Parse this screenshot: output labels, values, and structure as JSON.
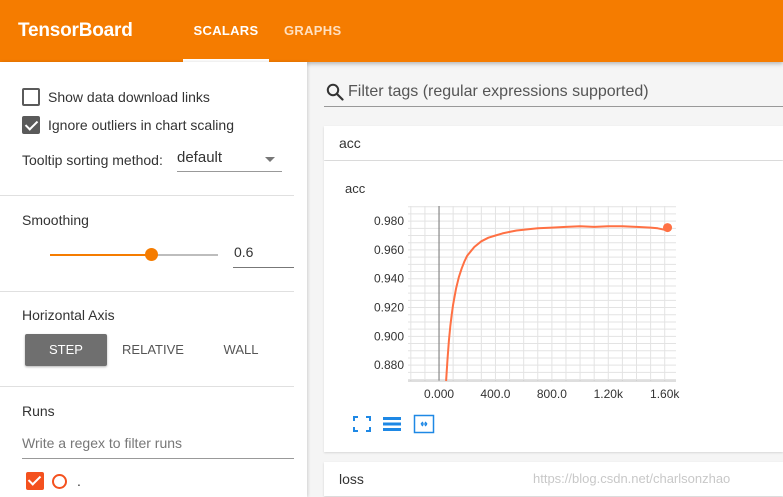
{
  "header": {
    "brand": "TensorBoard",
    "tabs": [
      {
        "label": "SCALARS",
        "active": true
      },
      {
        "label": "GRAPHS",
        "active": false
      }
    ],
    "color": "#f57c00"
  },
  "sidebar": {
    "show_download_label": "Show data download links",
    "show_download_checked": false,
    "ignore_outliers_label": "Ignore outliers in chart scaling",
    "ignore_outliers_checked": true,
    "tooltip_label": "Tooltip sorting method:",
    "tooltip_value": "default",
    "smoothing_title": "Smoothing",
    "smoothing_value": "0.6",
    "smoothing_fraction": 0.6,
    "axis_title": "Horizontal Axis",
    "axis_options": [
      "STEP",
      "RELATIVE",
      "WALL"
    ],
    "axis_selected": "STEP",
    "runs_title": "Runs",
    "runs_placeholder": "Write a regex to filter runs",
    "run_name": ".",
    "run_color": "#f4511e"
  },
  "main": {
    "filter_placeholder": "Filter tags (regular expressions supported)",
    "group_acc": "acc",
    "group_loss": "loss",
    "chart_title": "acc"
  },
  "chart_data": {
    "type": "line",
    "title": "acc",
    "xlabel": "",
    "ylabel": "",
    "xlim": [
      -220,
      1680
    ],
    "ylim": [
      0.869,
      0.9905
    ],
    "xticks": [
      0,
      400,
      800,
      1200,
      1600
    ],
    "xtick_labels": [
      "0.000",
      "400.0",
      "800.0",
      "1.20k",
      "1.60k"
    ],
    "yticks": [
      0.88,
      0.9,
      0.92,
      0.94,
      0.96,
      0.98
    ],
    "ytick_labels": [
      "0.880",
      "0.900",
      "0.920",
      "0.940",
      "0.960",
      "0.980"
    ],
    "grid": true,
    "series": [
      {
        "color": "#ff7043",
        "x": [
          50,
          60,
          70,
          80,
          90,
          100,
          120,
          140,
          160,
          180,
          200,
          250,
          300,
          350,
          400,
          450,
          500,
          550,
          600,
          650,
          700,
          800,
          900,
          1000,
          1100,
          1200,
          1300,
          1400,
          1500,
          1550,
          1600,
          1620
        ],
        "y": [
          0.869,
          0.884,
          0.897,
          0.907,
          0.915,
          0.922,
          0.933,
          0.941,
          0.947,
          0.952,
          0.956,
          0.962,
          0.966,
          0.9685,
          0.97,
          0.9715,
          0.9725,
          0.9735,
          0.974,
          0.9745,
          0.975,
          0.9755,
          0.976,
          0.9765,
          0.976,
          0.9765,
          0.9765,
          0.976,
          0.9755,
          0.975,
          0.974,
          0.9755
        ]
      }
    ]
  },
  "watermark": "https://blog.csdn.net/charlsonzhao"
}
